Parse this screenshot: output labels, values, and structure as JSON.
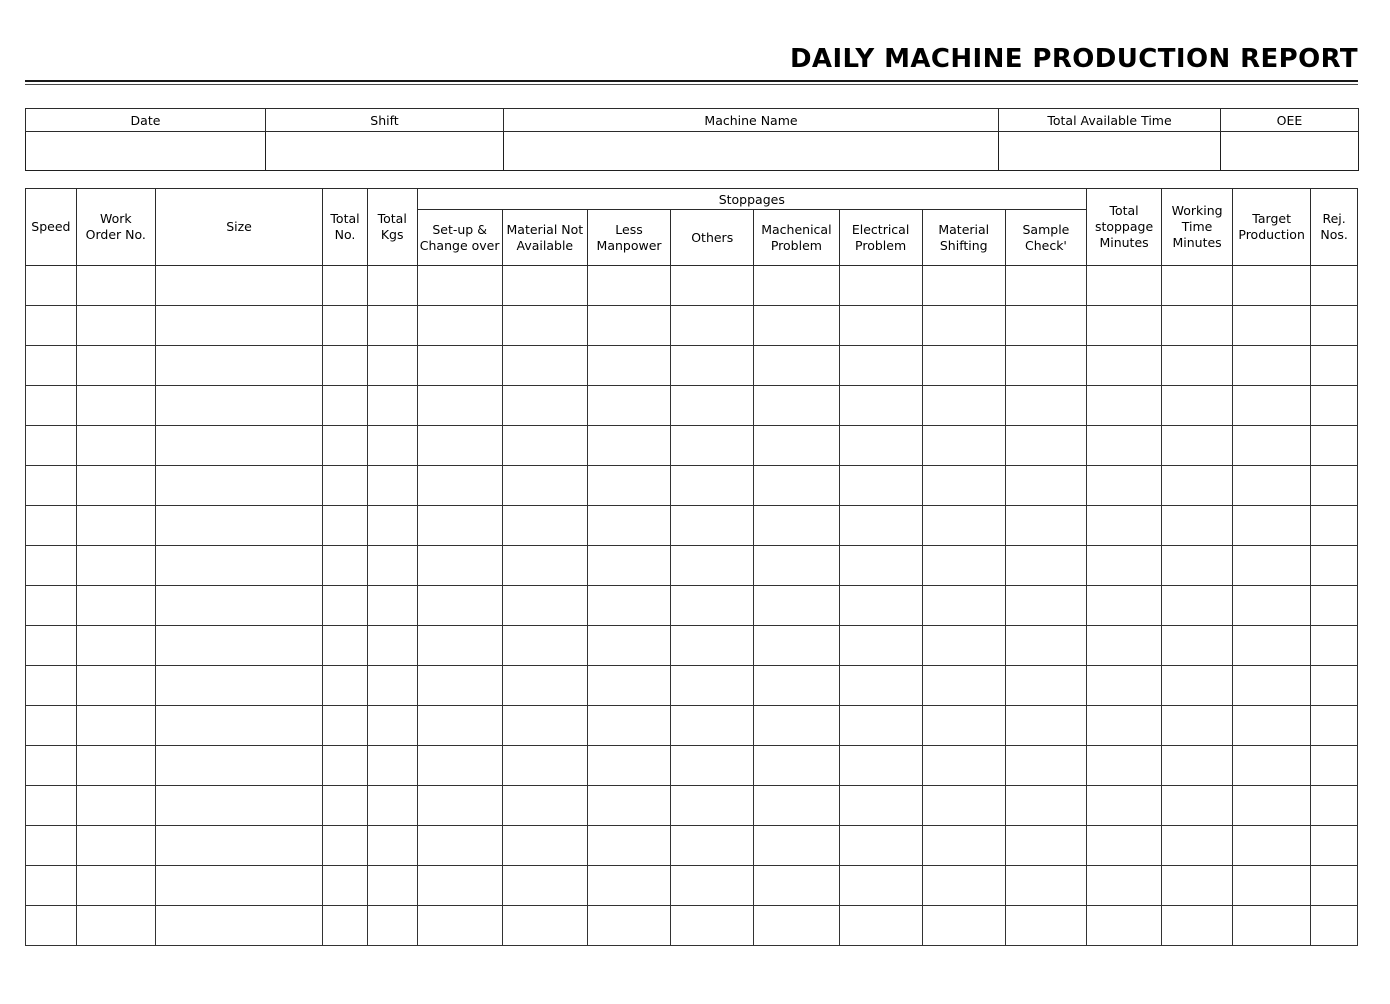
{
  "document": {
    "title": "DAILY MACHINE PRODUCTION REPORT"
  },
  "colors": {
    "header_yellow": "#FBFB9C",
    "header_green": "#D2F7D2",
    "grid_line": "#2B2B2B",
    "text": "#000000",
    "page_background": "#FFFFFF"
  },
  "info_table": {
    "headers": [
      {
        "label": "Date"
      },
      {
        "label": "Shift"
      },
      {
        "label": "Machine Name"
      },
      {
        "label": "Total Available Time"
      },
      {
        "label": "OEE"
      }
    ],
    "values": [
      {
        "value": ""
      },
      {
        "value": ""
      },
      {
        "value": ""
      },
      {
        "value": ""
      },
      {
        "value": ""
      }
    ]
  },
  "main_table": {
    "group_header": {
      "label": "Stoppages",
      "span": 8
    },
    "columns": [
      {
        "label": "Speed",
        "lines": [
          "Speed"
        ]
      },
      {
        "label": "Work Order No.",
        "lines": [
          "Work",
          "Order No."
        ]
      },
      {
        "label": "Size",
        "lines": [
          "Size"
        ]
      },
      {
        "label": "Total No.",
        "lines": [
          "Total",
          "No."
        ]
      },
      {
        "label": "Total Kgs",
        "lines": [
          "Total",
          "Kgs"
        ]
      },
      {
        "label": "Set-up & Change over",
        "lines": [
          "Set-up &",
          "Change over"
        ]
      },
      {
        "label": "Material Not Available",
        "lines": [
          "Material Not",
          "Available"
        ]
      },
      {
        "label": "Less Manpower",
        "lines": [
          "Less",
          "Manpower"
        ]
      },
      {
        "label": "Others",
        "lines": [
          "Others"
        ]
      },
      {
        "label": "Machenical Problem",
        "lines": [
          "Machenical",
          "Problem"
        ]
      },
      {
        "label": "Electrical Problem",
        "lines": [
          "Electrical",
          "Problem"
        ]
      },
      {
        "label": "Material Shifting",
        "lines": [
          "Material",
          "Shifting"
        ]
      },
      {
        "label": "Sample Check'",
        "lines": [
          "Sample",
          "Check'"
        ]
      },
      {
        "label": "Total stoppage Minutes",
        "lines": [
          "Total",
          "stoppage",
          "Minutes"
        ]
      },
      {
        "label": "Working Time Minutes",
        "lines": [
          "Working",
          "Time",
          "Minutes"
        ]
      },
      {
        "label": "Target Production",
        "lines": [
          "Target",
          "Production"
        ]
      },
      {
        "label": "Rej. Nos.",
        "lines": [
          "Rej.",
          "Nos."
        ]
      }
    ],
    "row_count": 17,
    "rows": [
      [
        "",
        "",
        "",
        "",
        "",
        "",
        "",
        "",
        "",
        "",
        "",
        "",
        "",
        "",
        "",
        "",
        ""
      ],
      [
        "",
        "",
        "",
        "",
        "",
        "",
        "",
        "",
        "",
        "",
        "",
        "",
        "",
        "",
        "",
        "",
        ""
      ],
      [
        "",
        "",
        "",
        "",
        "",
        "",
        "",
        "",
        "",
        "",
        "",
        "",
        "",
        "",
        "",
        "",
        ""
      ],
      [
        "",
        "",
        "",
        "",
        "",
        "",
        "",
        "",
        "",
        "",
        "",
        "",
        "",
        "",
        "",
        "",
        ""
      ],
      [
        "",
        "",
        "",
        "",
        "",
        "",
        "",
        "",
        "",
        "",
        "",
        "",
        "",
        "",
        "",
        "",
        ""
      ],
      [
        "",
        "",
        "",
        "",
        "",
        "",
        "",
        "",
        "",
        "",
        "",
        "",
        "",
        "",
        "",
        "",
        ""
      ],
      [
        "",
        "",
        "",
        "",
        "",
        "",
        "",
        "",
        "",
        "",
        "",
        "",
        "",
        "",
        "",
        "",
        ""
      ],
      [
        "",
        "",
        "",
        "",
        "",
        "",
        "",
        "",
        "",
        "",
        "",
        "",
        "",
        "",
        "",
        "",
        ""
      ],
      [
        "",
        "",
        "",
        "",
        "",
        "",
        "",
        "",
        "",
        "",
        "",
        "",
        "",
        "",
        "",
        "",
        ""
      ],
      [
        "",
        "",
        "",
        "",
        "",
        "",
        "",
        "",
        "",
        "",
        "",
        "",
        "",
        "",
        "",
        "",
        ""
      ],
      [
        "",
        "",
        "",
        "",
        "",
        "",
        "",
        "",
        "",
        "",
        "",
        "",
        "",
        "",
        "",
        "",
        ""
      ],
      [
        "",
        "",
        "",
        "",
        "",
        "",
        "",
        "",
        "",
        "",
        "",
        "",
        "",
        "",
        "",
        "",
        ""
      ],
      [
        "",
        "",
        "",
        "",
        "",
        "",
        "",
        "",
        "",
        "",
        "",
        "",
        "",
        "",
        "",
        "",
        ""
      ],
      [
        "",
        "",
        "",
        "",
        "",
        "",
        "",
        "",
        "",
        "",
        "",
        "",
        "",
        "",
        "",
        "",
        ""
      ],
      [
        "",
        "",
        "",
        "",
        "",
        "",
        "",
        "",
        "",
        "",
        "",
        "",
        "",
        "",
        "",
        "",
        ""
      ],
      [
        "",
        "",
        "",
        "",
        "",
        "",
        "",
        "",
        "",
        "",
        "",
        "",
        "",
        "",
        "",
        "",
        ""
      ],
      [
        "",
        "",
        "",
        "",
        "",
        "",
        "",
        "",
        "",
        "",
        "",
        "",
        "",
        "",
        "",
        "",
        ""
      ]
    ]
  }
}
